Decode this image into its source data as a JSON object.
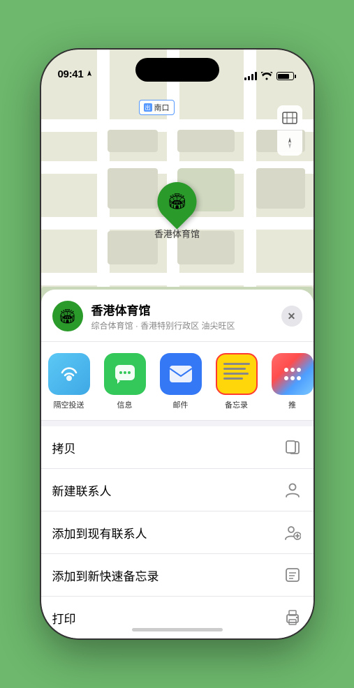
{
  "status_bar": {
    "time": "09:41",
    "location_arrow": "▶"
  },
  "map": {
    "label_text": "南口",
    "label_prefix": "出"
  },
  "map_controls": {
    "map_icon": "🗺",
    "location_icon": "➤"
  },
  "location_card": {
    "name": "香港体育馆",
    "description": "综合体育馆 · 香港特别行政区 油尖旺区",
    "close_label": "✕"
  },
  "share_actions": [
    {
      "id": "airdrop",
      "label": "隔空投送"
    },
    {
      "id": "message",
      "label": "信息"
    },
    {
      "id": "mail",
      "label": "邮件"
    },
    {
      "id": "notes",
      "label": "备忘录"
    },
    {
      "id": "more",
      "label": "推"
    }
  ],
  "action_items": [
    {
      "label": "拷贝",
      "icon": "copy"
    },
    {
      "label": "新建联系人",
      "icon": "person"
    },
    {
      "label": "添加到现有联系人",
      "icon": "person-add"
    },
    {
      "label": "添加到新快速备忘录",
      "icon": "note"
    },
    {
      "label": "打印",
      "icon": "print"
    }
  ]
}
